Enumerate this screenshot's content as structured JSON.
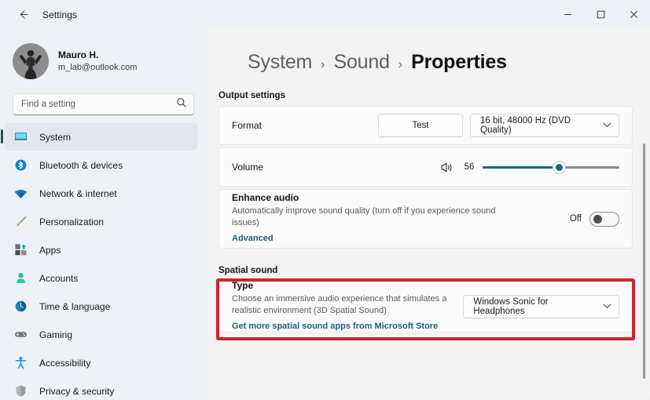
{
  "window": {
    "title": "Settings",
    "back_icon": "back-arrow-icon",
    "minimize_label": "Minimize",
    "maximize_label": "Maximize",
    "close_label": "Close"
  },
  "account": {
    "name": "Mauro H.",
    "email": "m_lab@outlook.com",
    "avatar_icon": "user-avatar-icon"
  },
  "search": {
    "placeholder": "Find a setting",
    "value": "",
    "icon": "search-icon"
  },
  "sidebar": {
    "items": [
      {
        "label": "System",
        "icon": "monitor-icon",
        "selected": true
      },
      {
        "label": "Bluetooth & devices",
        "icon": "bluetooth-icon",
        "selected": false
      },
      {
        "label": "Network & internet",
        "icon": "wifi-icon",
        "selected": false
      },
      {
        "label": "Personalization",
        "icon": "paintbrush-icon",
        "selected": false
      },
      {
        "label": "Apps",
        "icon": "apps-grid-icon",
        "selected": false
      },
      {
        "label": "Accounts",
        "icon": "person-icon",
        "selected": false
      },
      {
        "label": "Time & language",
        "icon": "clock-icon",
        "selected": false
      },
      {
        "label": "Gaming",
        "icon": "gamepad-icon",
        "selected": false
      },
      {
        "label": "Accessibility",
        "icon": "accessibility-icon",
        "selected": false
      },
      {
        "label": "Privacy & security",
        "icon": "shield-icon",
        "selected": false
      }
    ]
  },
  "breadcrumb": {
    "crumb1": "System",
    "sep1": "›",
    "crumb2": "Sound",
    "sep2": "›",
    "current": "Properties"
  },
  "output_settings": {
    "heading": "Output settings",
    "format": {
      "label": "Format",
      "test_button": "Test",
      "selected": "16 bit, 48000 Hz (DVD Quality)",
      "chevron": "⌄"
    },
    "volume": {
      "label": "Volume",
      "icon": "speaker-volume-icon",
      "value": "56",
      "percent": 56,
      "min": 0,
      "max": 100
    },
    "enhance_audio": {
      "title": "Enhance audio",
      "description": "Automatically improve sound quality (turn off if you experience sound issues)",
      "link": "Advanced",
      "toggle_state": "Off",
      "toggle_on": false
    }
  },
  "spatial_sound": {
    "heading": "Spatial sound",
    "type": {
      "title": "Type",
      "description": "Choose an immersive audio experience that simulates a realistic environment (3D Spatial Sound)",
      "link": "Get more spatial sound apps from Microsoft Store",
      "selected": "Windows Sonic for Headphones",
      "chevron": "⌄"
    },
    "highlight_color": "#d0232f"
  },
  "colors": {
    "accent": "#186a75",
    "link": "#1f5f78",
    "highlight": "#d0232f",
    "sidebar_bg": "#eef1f6",
    "content_bg": "#f3f3f3",
    "card_bg": "#fbfbfb"
  }
}
